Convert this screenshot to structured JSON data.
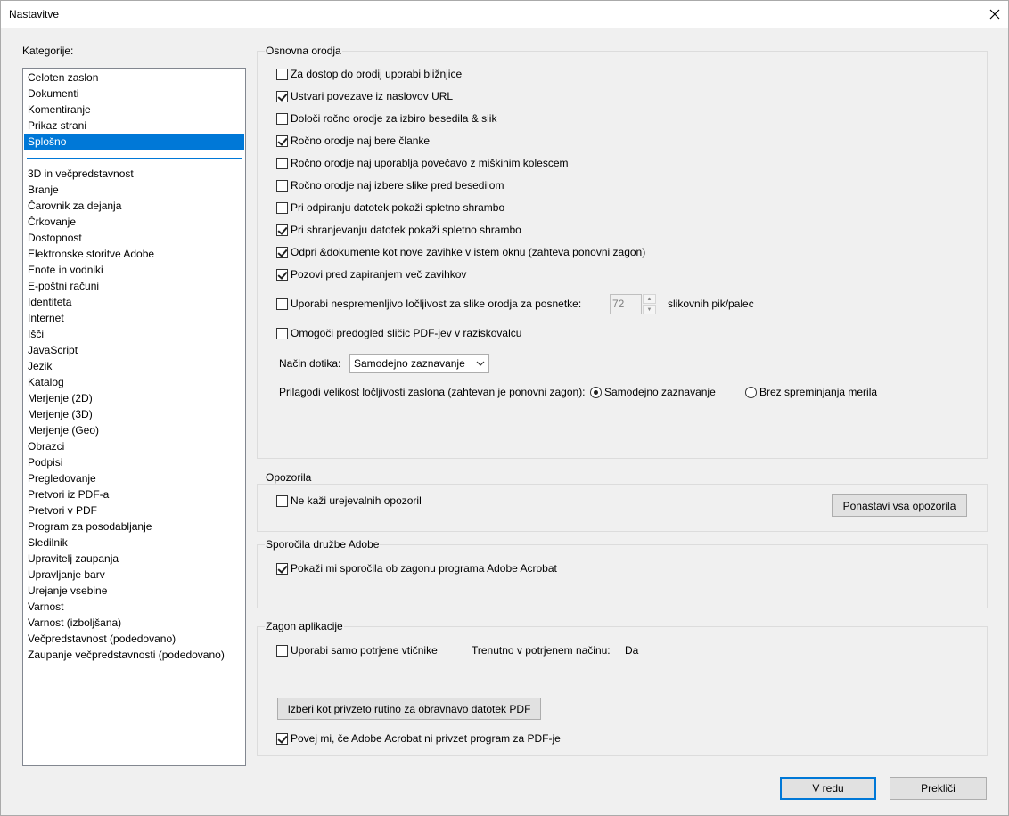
{
  "window": {
    "title": "Nastavitve"
  },
  "sidebar": {
    "label": "Kategorije:",
    "top_items": [
      "Celoten zaslon",
      "Dokumenti",
      "Komentiranje",
      "Prikaz strani",
      "Splošno"
    ],
    "selected": "Splošno",
    "items": [
      "3D in večpredstavnost",
      "Branje",
      "Čarovnik za dejanja",
      "Črkovanje",
      "Dostopnost",
      "Elektronske storitve Adobe",
      "Enote in vodniki",
      "E-poštni računi",
      "Identiteta",
      "Internet",
      "Išči",
      "JavaScript",
      "Jezik",
      "Katalog",
      "Merjenje (2D)",
      "Merjenje (3D)",
      "Merjenje (Geo)",
      "Obrazci",
      "Podpisi",
      "Pregledovanje",
      "Pretvori iz PDF-a",
      "Pretvori v PDF",
      "Program za posodabljanje",
      "Sledilnik",
      "Upravitelj zaupanja",
      "Upravljanje barv",
      "Urejanje vsebine",
      "Varnost",
      "Varnost (izboljšana)",
      "Večpredstavnost (podedovano)",
      "Zaupanje večpredstavnosti (podedovano)"
    ]
  },
  "basic_tools": {
    "title": "Osnovna orodja",
    "options": [
      {
        "label": "Za dostop do orodij uporabi bližnjice",
        "checked": false
      },
      {
        "label": "Ustvari povezave iz naslovov URL",
        "checked": true
      },
      {
        "label": "Določi ročno orodje za izbiro besedila & slik",
        "checked": false
      },
      {
        "label": "Ročno orodje naj bere članke",
        "checked": true
      },
      {
        "label": "Ročno orodje naj uporablja povečavo z miškinim kolescem",
        "checked": false
      },
      {
        "label": "Ročno orodje naj izbere slike pred besedilom",
        "checked": false
      },
      {
        "label": "Pri odpiranju datotek pokaži spletno shrambo",
        "checked": false
      },
      {
        "label": "Pri shranjevanju datotek pokaži spletno shrambo",
        "checked": true
      },
      {
        "label": "Odpri &dokumente kot nove zavihke v istem oknu (zahteva ponovni zagon)",
        "checked": true
      },
      {
        "label": "Pozovi pred zapiranjem več zavihkov",
        "checked": true
      }
    ],
    "resolution": {
      "label": "Uporabi nespremenljivo ločljivost za slike orodja za posnetke:",
      "checked": false,
      "value": "72",
      "unit": "slikovnih pik/palec"
    },
    "thumbnail_preview": {
      "label": "Omogoči predogled sličic PDF-jev v raziskovalcu",
      "checked": false
    },
    "touch_mode": {
      "label": "Način dotika:",
      "value": "Samodejno zaznavanje"
    },
    "screen_scaling": {
      "label": "Prilagodi velikost ločljivosti zaslona (zahtevan je ponovni zagon):",
      "option1": "Samodejno zaznavanje",
      "option2": "Brez spreminjanja merila",
      "selected": "option1"
    }
  },
  "warnings": {
    "title": "Opozorila",
    "checkbox_label": "Ne kaži urejevalnih opozoril",
    "checked": false,
    "reset_label": "Ponastavi vsa opozorila"
  },
  "adobe_messages": {
    "title": "Sporočila družbe Adobe",
    "checkbox_label": "Pokaži mi sporočila ob zagonu programa Adobe Acrobat",
    "checked": true
  },
  "app_startup": {
    "title": "Zagon aplikacije",
    "certified_label": "Uporabi samo potrjene vtičnike",
    "certified_checked": false,
    "current_mode_label": "Trenutno v potrjenem načinu:",
    "current_mode_value": "Da",
    "default_handler_label": "Izberi kot privzeto rutino za obravnavo datotek PDF",
    "notify_label": "Povej mi, če Adobe Acrobat ni privzet program za PDF-je",
    "notify_checked": true
  },
  "footer": {
    "ok_label": "V redu",
    "cancel_label": "Prekliči"
  }
}
